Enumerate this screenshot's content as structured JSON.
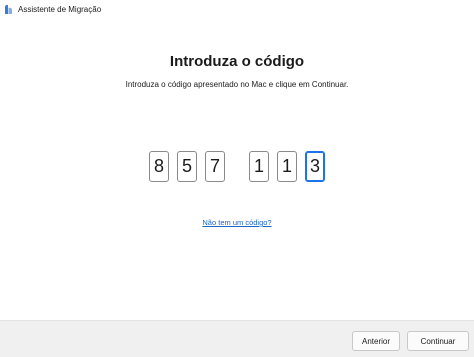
{
  "window": {
    "title": "Assistente de Migração",
    "icon": "migration-assistant-icon"
  },
  "main": {
    "heading": "Introduza o código",
    "instruction": "Introduza o código apresentado no Mac e clique em Continuar.",
    "code_digits": [
      "8",
      "5",
      "7",
      "1",
      "1",
      "3"
    ],
    "no_code_link": "Não tem um código?"
  },
  "footer": {
    "back_label": "Anterior",
    "continue_label": "Continuar"
  },
  "colors": {
    "accent": "#1a73e8",
    "link": "#1a66c9",
    "footer_bg": "#f0f0f0"
  }
}
